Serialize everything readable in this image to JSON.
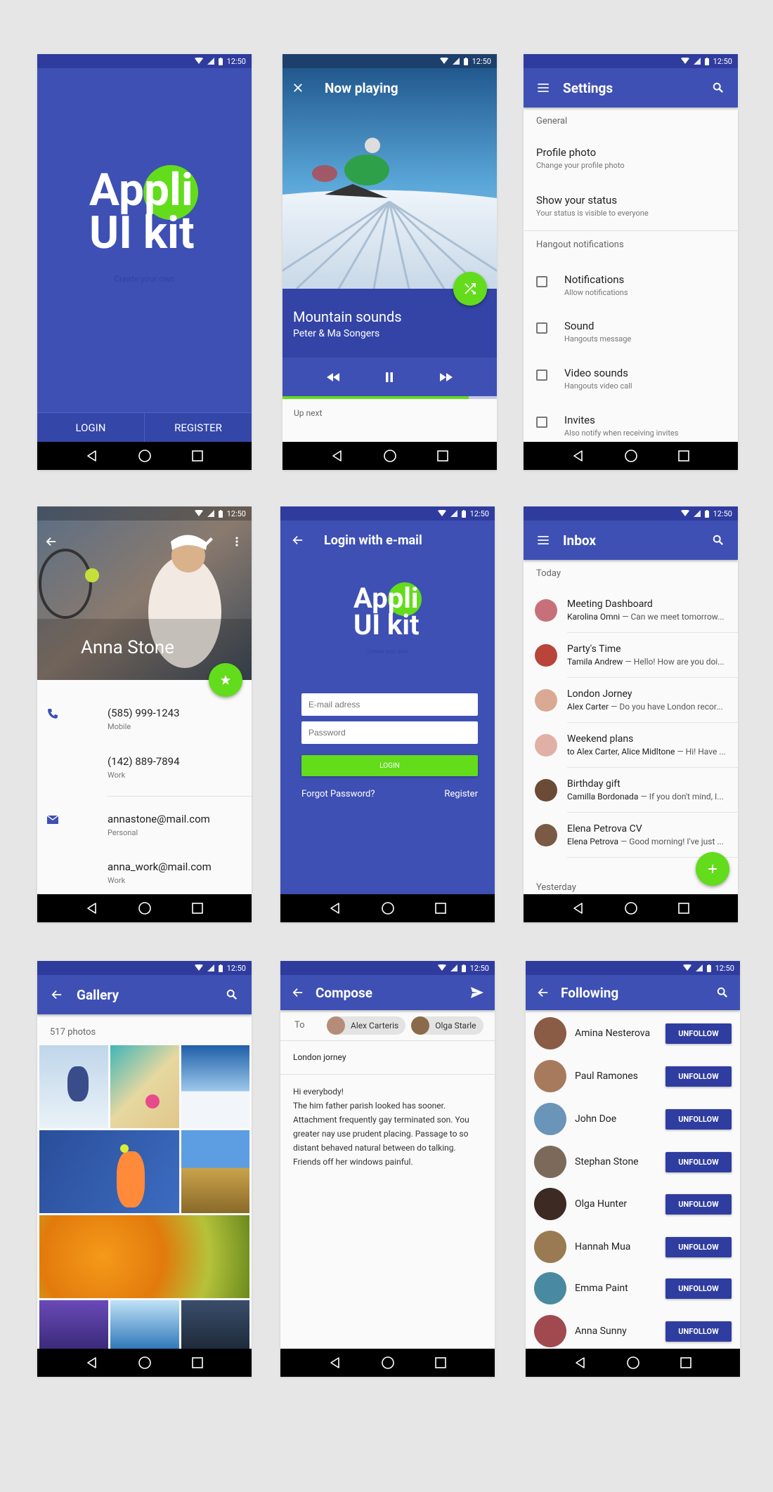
{
  "status": {
    "time": "12:50"
  },
  "colors": {
    "primary": "#3e50b4",
    "primary_dark": "#2f3c9e",
    "accent": "#63dc1b",
    "nav": "#000000"
  },
  "splash": {
    "logo_line1": "Appli",
    "logo_line2": "UI kit",
    "tagline": "Create your own",
    "login_label": "LOGIN",
    "register_label": "REGISTER"
  },
  "player": {
    "title": "Now playing",
    "song": "Mountain sounds",
    "artist": "Peter & Ma Songers",
    "up_next": "Up next",
    "progress": 0.87
  },
  "settings": {
    "title": "Settings",
    "section_general": "General",
    "general_items": [
      {
        "title": "Profile photo",
        "sub": "Change your profile photo"
      },
      {
        "title": "Show your status",
        "sub": "Your status is visible to everyone"
      }
    ],
    "section_hangout": "Hangout notifications",
    "hangout_items": [
      {
        "title": "Notifications",
        "sub": "Allow notifications"
      },
      {
        "title": "Sound",
        "sub": "Hangouts message"
      },
      {
        "title": "Video sounds",
        "sub": "Hangouts video call"
      },
      {
        "title": "Invites",
        "sub": "Also notify when receiving invites"
      }
    ]
  },
  "contact": {
    "name": "Anna Stone",
    "phones": [
      {
        "value": "(585) 999-1243",
        "label": "Mobile"
      },
      {
        "value": "(142) 889-7894",
        "label": "Work"
      }
    ],
    "emails": [
      {
        "value": "annastone@mail.com",
        "label": "Personal"
      },
      {
        "value": "anna_work@mail.com",
        "label": "Work"
      }
    ]
  },
  "login": {
    "title": "Login with e-mail",
    "logo_line1": "Appli",
    "logo_line2": "UI kit",
    "tagline": "Create your own",
    "email_placeholder": "E-mail adress",
    "password_placeholder": "Password",
    "button_label": "LOGIN",
    "forgot_label": "Forgot Password?",
    "register_label": "Register"
  },
  "inbox": {
    "title": "Inbox",
    "section_today": "Today",
    "section_yesterday": "Yesterday",
    "messages": [
      {
        "subject": "Meeting Dashboard",
        "from": "Karolina Omni",
        "snippet": " — Can we meet tomorrow...",
        "avatar": "#c8707a"
      },
      {
        "subject": "Party's Time",
        "from": "Tamila Andrew",
        "snippet": " — Hello! How are you doi...",
        "avatar": "#b8443a"
      },
      {
        "subject": "London Jorney",
        "from": "Alex Carter",
        "snippet": " — Do you have London recor...",
        "avatar": "#d9a994"
      },
      {
        "subject": "Weekend plans",
        "from": "to Alex Carter, Alice Midltone",
        "snippet": " — Hi! Have ...",
        "avatar": "#e0b0a6"
      },
      {
        "subject": "Birthday gift",
        "from": "Camilla Bordonada",
        "snippet": " — If you don't mind, I...",
        "avatar": "#6b4a36"
      },
      {
        "subject": "Elena Petrova CV",
        "from": "Elena Petrova",
        "snippet": " — Good morning! I've just ...",
        "avatar": "#7a5a44"
      }
    ]
  },
  "gallery": {
    "title": "Gallery",
    "count": "517 photos"
  },
  "compose": {
    "title": "Compose",
    "to_label": "To",
    "recipients": [
      "Alex Carteris",
      "Olga Starle"
    ],
    "subject": "London jorney",
    "body_lines": [
      "Hi everybody!",
      "The him father parish looked has sooner.",
      "Attachment frequently gay terminated son. You",
      "greater nay use prudent placing. Passage to so",
      "distant behaved natural between do talking.",
      "Friends off her windows painful."
    ]
  },
  "following": {
    "title": "Following",
    "button_label": "UNFOLLOW",
    "people": [
      {
        "name": "Amina Nesterova",
        "avatar": "#8a5b45"
      },
      {
        "name": "Paul Ramones",
        "avatar": "#a77a5e"
      },
      {
        "name": "John Doe",
        "avatar": "#6a94b8"
      },
      {
        "name": "Stephan Stone",
        "avatar": "#7b6a5a"
      },
      {
        "name": "Olga Hunter",
        "avatar": "#3d2a22"
      },
      {
        "name": "Hannah Mua",
        "avatar": "#9a7a52"
      },
      {
        "name": "Emma Paint",
        "avatar": "#4a8aa0"
      },
      {
        "name": "Anna Sunny",
        "avatar": "#a04a50"
      }
    ]
  }
}
